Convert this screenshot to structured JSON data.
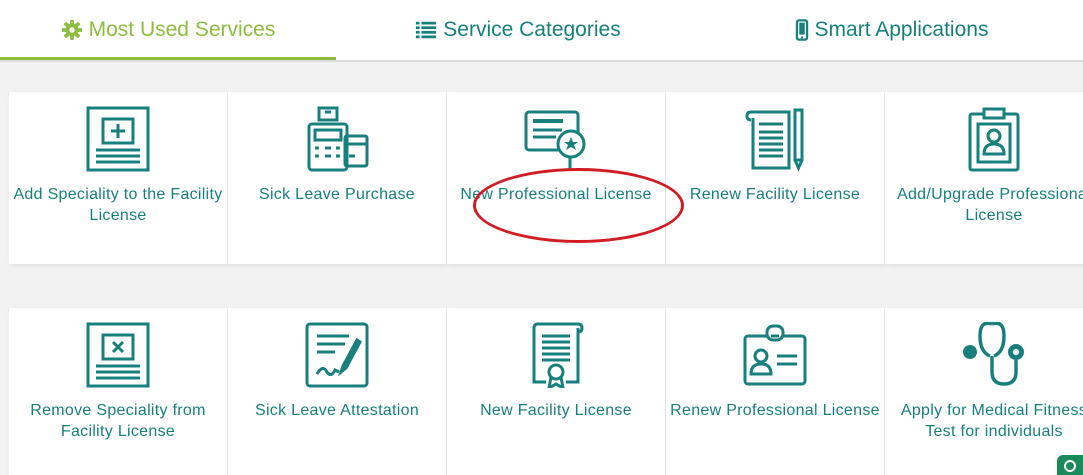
{
  "tabs": [
    {
      "label": "Most Used Services",
      "icon": "gear-icon",
      "active": true
    },
    {
      "label": "Service Categories",
      "icon": "list-icon",
      "active": false
    },
    {
      "label": "Smart Applications",
      "icon": "mobile-icon",
      "active": false
    }
  ],
  "services": [
    {
      "label": "Add Speciality to the Facility License",
      "icon": "add-document-icon"
    },
    {
      "label": "Sick Leave Purchase",
      "icon": "cash-register-icon"
    },
    {
      "label": "New Professional License",
      "icon": "certificate-icon",
      "highlighted": true
    },
    {
      "label": "Renew Facility License",
      "icon": "scroll-pen-icon"
    },
    {
      "label": "Add/Upgrade Professional License",
      "icon": "clipboard-user-icon"
    },
    {
      "label": "Remove Speciality from Facility License",
      "icon": "remove-document-icon"
    },
    {
      "label": "Sick Leave Attestation",
      "icon": "signed-document-icon"
    },
    {
      "label": "New Facility License",
      "icon": "scroll-seal-icon"
    },
    {
      "label": "Renew Professional License",
      "icon": "id-badge-icon"
    },
    {
      "label": "Apply for Medical Fitness Test for individuals",
      "icon": "stethoscope-icon"
    }
  ],
  "colors": {
    "accent": "#8ebc3f",
    "primary": "#17807d",
    "highlight": "#d01d24"
  }
}
